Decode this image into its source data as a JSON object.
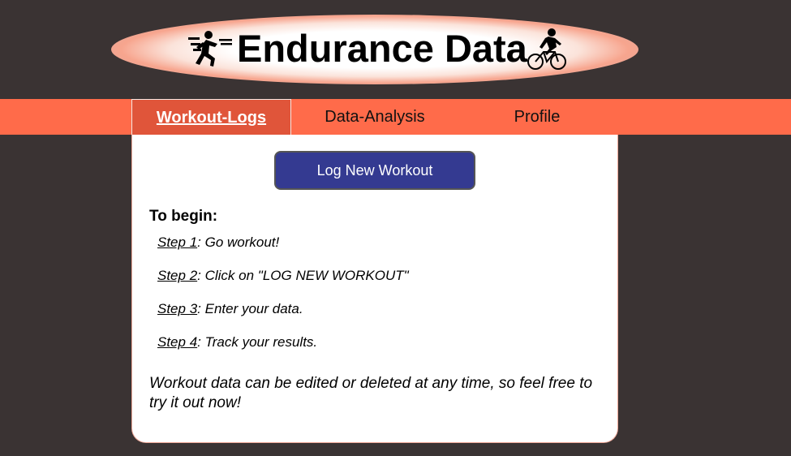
{
  "header": {
    "title": "Endurance Data",
    "left_icon": "runner-icon",
    "right_icon": "cyclist-icon"
  },
  "nav": {
    "tabs": [
      {
        "label": "Workout-Logs",
        "active": true
      },
      {
        "label": "Data-Analysis",
        "active": false
      },
      {
        "label": "Profile",
        "active": false
      }
    ]
  },
  "main": {
    "log_button": "Log New Workout",
    "begin_heading": "To begin:",
    "steps": [
      {
        "link": "Step 1",
        "text": ": Go workout!"
      },
      {
        "link": "Step 2",
        "text": ": Click on \"LOG NEW WORKOUT\""
      },
      {
        "link": "Step 3",
        "text": ": Enter your data."
      },
      {
        "link": "Step 4",
        "text": ": Track your results."
      }
    ],
    "note": "Workout data can be edited or deleted at any time, so feel free to try it out now!"
  },
  "colors": {
    "background": "#3a3333",
    "nav": "#ff6b4a",
    "active_tab": "#e0553a",
    "button": "#343a91"
  }
}
